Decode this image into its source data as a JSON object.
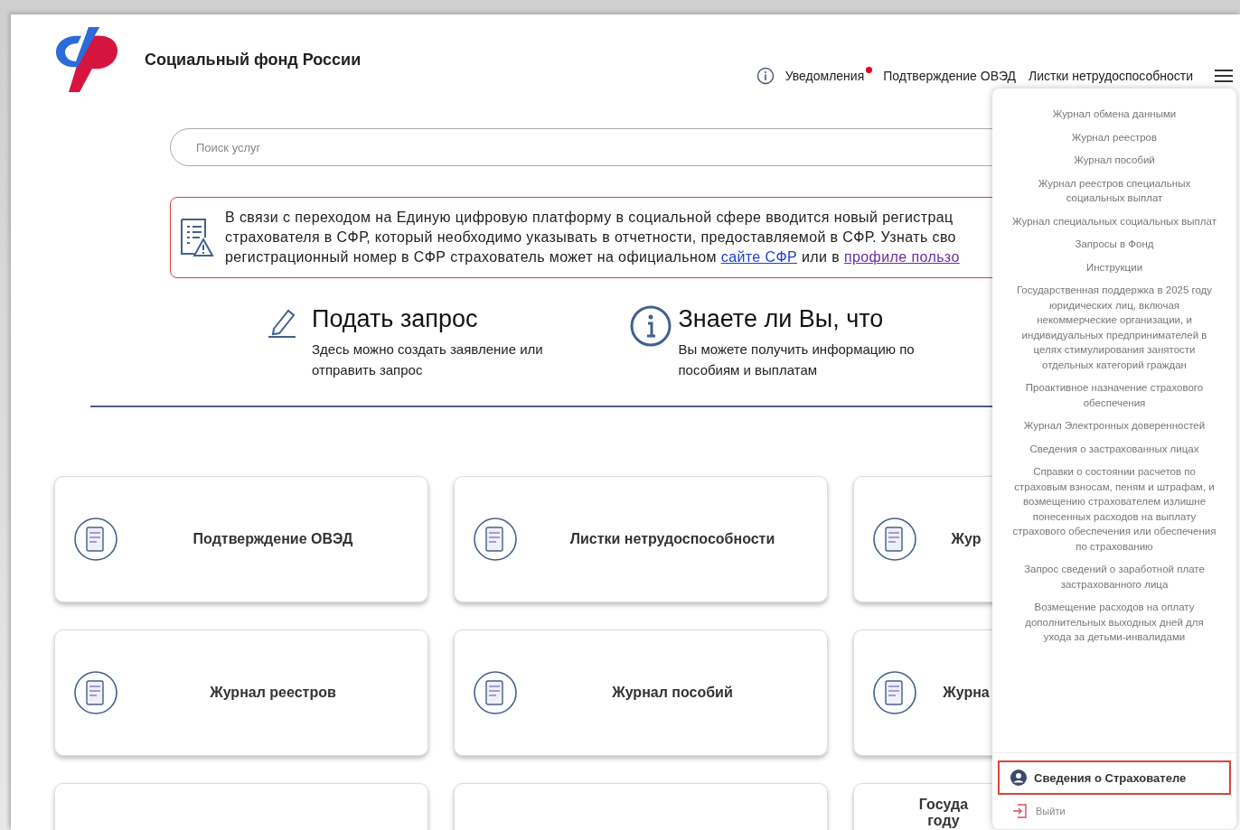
{
  "header": {
    "title": "Социальный фонд России",
    "nav": [
      {
        "label": "Уведомления",
        "kind": "notifications",
        "unread": true
      },
      {
        "label": "Подтверждение ОВЭД",
        "kind": "link"
      },
      {
        "label": "Листки нетрудоспособности",
        "kind": "link"
      }
    ]
  },
  "search": {
    "placeholder": "Поиск услуг"
  },
  "notice": {
    "lines": [
      [
        {
          "text": "В связи с переходом на Единую цифровую платформу в социальной сфере вводится новый регистрац",
          "kind": "text"
        }
      ],
      [
        {
          "text": "страхователя в СФР, который необходимо указывать в отчетности, предоставляемой в СФР. Узнать сво",
          "kind": "text"
        }
      ],
      [
        {
          "text": "регистрационный номер в СФР страхователь может на официальном ",
          "kind": "text"
        },
        {
          "text": "сайте СФР",
          "kind": "link",
          "visited": false
        },
        {
          "text": " или в ",
          "kind": "text"
        },
        {
          "text": "профиле пользо",
          "kind": "link",
          "visited": true
        }
      ]
    ]
  },
  "info_blocks": [
    {
      "kind": "request",
      "title": "Подать запрос",
      "text": "Здесь можно создать заявление или отправить запрос"
    },
    {
      "kind": "info",
      "title": "Знаете ли Вы, что",
      "text": "Вы можете получить информацию по пособиям и выплатам"
    }
  ],
  "cards": [
    {
      "kind": "service",
      "label": "Подтверждение ОВЭД"
    },
    {
      "kind": "service",
      "label": "Листки нетрудоспособности"
    },
    {
      "kind": "service",
      "label": "Жур"
    },
    {
      "kind": "service",
      "label": "Журнал реестров"
    },
    {
      "kind": "service",
      "label": "Журнал пособий"
    },
    {
      "kind": "service",
      "label": "Журна"
    },
    {
      "kind": "blank"
    },
    {
      "kind": "blank"
    },
    {
      "kind": "text",
      "label": "Госуда\nгоду"
    }
  ],
  "menu": {
    "items": [
      "Журнал обмена данными",
      "Журнал реестров",
      "Журнал пособий",
      "Журнал реестров специальных социальных выплат",
      "Журнал специальных социальных выплат",
      "Запросы в Фонд",
      "Инструкции",
      "Государственная поддержка в 2025 году юридических лиц, включая некоммерческие организации, и индивидуальных предпринимателей в целях стимулирования занятости отдельных категорий граждан",
      "Проактивное назначение страхового обеспечения",
      "Журнал Электронных доверенностей",
      "Сведения о застрахованных лицах",
      "Справки о состоянии расчетов по страховым взносам, пеням и штрафам, и возмещению страхователем излишне понесенных расходов на выплату страхового обеспечения или обеспечения по страхованию",
      "Запрос сведений о заработной плате застрахованного лица",
      "Возмещение расходов на оплату дополнительных выходных дней для ухода за детьми-инвалидами"
    ],
    "profile": {
      "label": "Сведения о Страхователе",
      "highlighted": true
    },
    "logout": {
      "label": "Выйти"
    }
  }
}
